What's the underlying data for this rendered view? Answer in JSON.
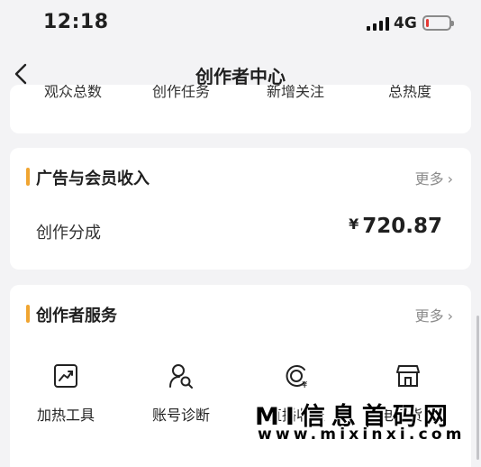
{
  "status_bar": {
    "time": "12:18",
    "network": "4G",
    "battery_level": 0.1,
    "battery_color": "#e53935"
  },
  "nav": {
    "title": "创作者中心",
    "back_icon": "chevron-left-icon"
  },
  "top_row": {
    "items": [
      {
        "label": "观众总数"
      },
      {
        "label": "创作任务"
      },
      {
        "label": "新增关注"
      },
      {
        "label": "总热度"
      }
    ]
  },
  "ad_income": {
    "title": "广告与会员收入",
    "more": "更多",
    "row_label": "创作分成",
    "currency": "¥",
    "amount": "720.87"
  },
  "services": {
    "title": "创作者服务",
    "more": "更多",
    "items": [
      {
        "label": "加热工具",
        "icon": "trend-chart-icon"
      },
      {
        "label": "账号诊断",
        "icon": "user-search-icon"
      },
      {
        "label": "直播收益",
        "icon": "income-icon"
      },
      {
        "label": "电商货架",
        "icon": "store-icon"
      }
    ]
  },
  "watermark": {
    "line1": "MI信息首码网",
    "line2": "www.mixinxi.com"
  },
  "colors": {
    "accent": "#f0a531",
    "background": "#f3f3f5",
    "card": "#ffffff",
    "muted": "#8c8c8c"
  }
}
